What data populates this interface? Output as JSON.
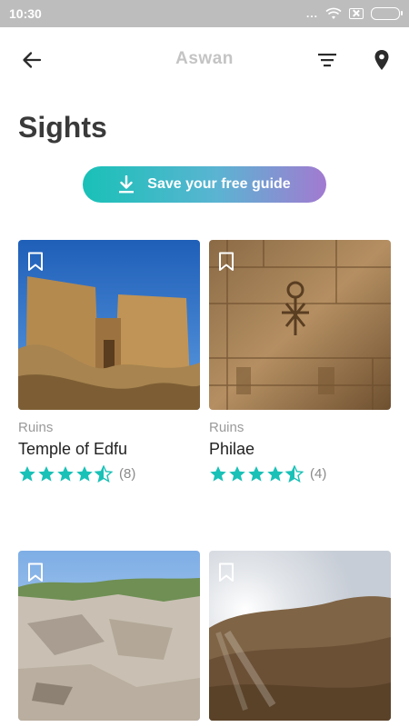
{
  "status_bar": {
    "time": "10:30",
    "more": "..."
  },
  "toolbar": {
    "title": "Aswan"
  },
  "page": {
    "title": "Sights"
  },
  "guide_button": {
    "label": "Save your free guide"
  },
  "accent_color": "#19c1b7",
  "cards": [
    {
      "category": "Ruins",
      "name": "Temple of Edfu",
      "rating": 4.5,
      "review_count": "(8)"
    },
    {
      "category": "Ruins",
      "name": "Philae",
      "rating": 4.5,
      "review_count": "(4)"
    },
    {
      "category": "",
      "name": "",
      "rating": null,
      "review_count": ""
    },
    {
      "category": "",
      "name": "",
      "rating": null,
      "review_count": ""
    }
  ],
  "icons": [
    "back-arrow-icon",
    "filter-icon",
    "location-pin-icon",
    "download-icon",
    "bookmark-icon",
    "star-icon",
    "half-star-icon",
    "wifi-icon",
    "sim-icon",
    "battery-icon"
  ]
}
